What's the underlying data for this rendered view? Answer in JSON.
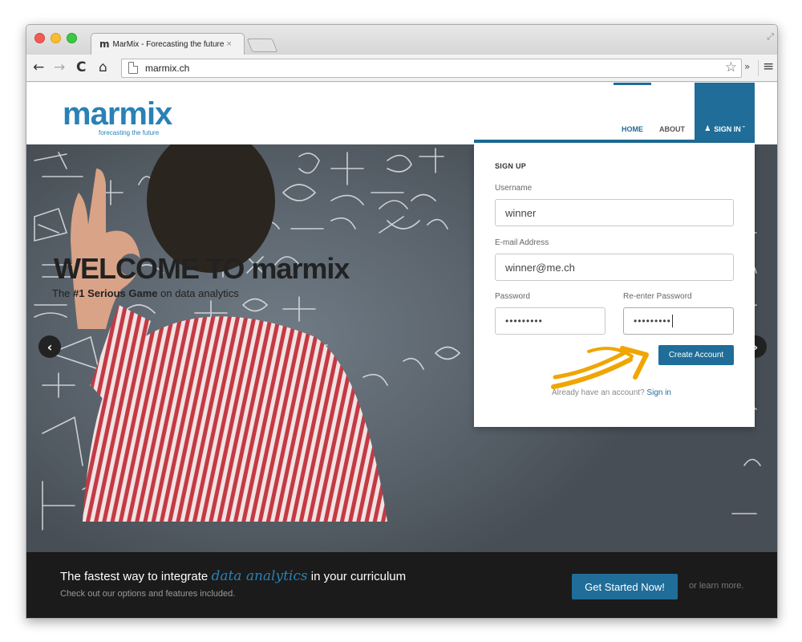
{
  "browser": {
    "tab_title": "MarMix - Forecasting the future",
    "tab_icon": "m-logo-icon",
    "tab_close": "×",
    "url": "marmix.ch",
    "ext_label": "»"
  },
  "header": {
    "logo_word": "marmix",
    "logo_tagline": "forecasting the future",
    "nav": [
      "HOME",
      "ABOUT",
      "SIGN IN"
    ],
    "active_nav": "HOME",
    "brand_color": "#1f6d98"
  },
  "hero": {
    "title": "WELCOME TO marmix",
    "subtitle_pre": "The ",
    "subtitle_bold": "#1 Serious Game",
    "subtitle_post": " on data analytics",
    "prev_arrow": "‹",
    "next_arrow": "›"
  },
  "signup": {
    "title": "SIGN UP",
    "username_label": "Username",
    "username_value": "winner",
    "email_label": "E-mail Address",
    "email_value": "winner@me.ch",
    "password_label": "Password",
    "password_value": "•••••••••",
    "repassword_label": "Re-enter Password",
    "repassword_value": "•••••••••",
    "submit_label": "Create Account",
    "footer_text": "Already have an account?",
    "footer_link": "Sign in"
  },
  "cta": {
    "title_pre": "The fastest way to integrate ",
    "title_script": "data analytics",
    "title_post": " in your curriculum",
    "subtitle": "Check out our options and features included.",
    "button_label": "Get Started Now!",
    "more_text": "or learn more.",
    "accent_color": "#2a81b6"
  }
}
